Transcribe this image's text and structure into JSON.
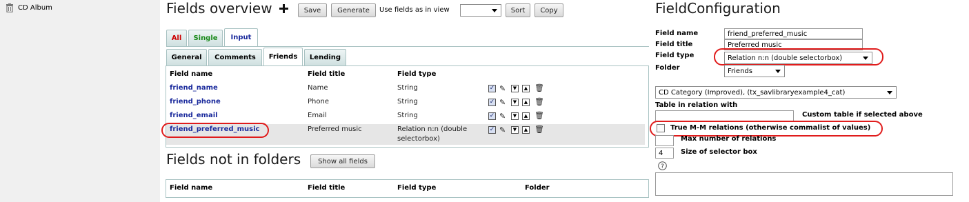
{
  "tree": {
    "item_label": "CD Album",
    "item_icon": "trash-icon"
  },
  "overview": {
    "title": "Fields overview",
    "add_icon": "plus-icon",
    "save_label": "Save",
    "generate_label": "Generate",
    "use_fields_label": "Use fields as in view",
    "view_select_value": "",
    "sort_label": "Sort",
    "copy_label": "Copy"
  },
  "filter_tabs": [
    {
      "label": "All",
      "color": "#cc0000"
    },
    {
      "label": "Single",
      "color": "#1a8a1a"
    },
    {
      "label": "Input",
      "color": "#1a2a9c"
    }
  ],
  "folder_tabs": [
    {
      "label": "General"
    },
    {
      "label": "Comments"
    },
    {
      "label": "Friends",
      "active": true
    },
    {
      "label": "Lending"
    }
  ],
  "fields_table": {
    "headers": {
      "name": "Field name",
      "title": "Field title",
      "type": "Field type"
    },
    "rows": [
      {
        "name": "friend_name",
        "title": "Name",
        "type": "String"
      },
      {
        "name": "friend_phone",
        "title": "Phone",
        "type": "String"
      },
      {
        "name": "friend_email",
        "title": "Email",
        "type": "String"
      },
      {
        "name": "friend_preferred_music",
        "title": "Preferred music",
        "type_line1": "Relation n:n (double",
        "type_line2": "selectorbox)"
      }
    ],
    "row_icons": [
      "checkbox-checked-icon",
      "edit-pen-icon",
      "move-down-icon",
      "move-up-icon",
      "delete-icon"
    ]
  },
  "not_in_folders": {
    "title": "Fields not in folders",
    "show_all_label": "Show all fields",
    "headers": {
      "name": "Field name",
      "title": "Field title",
      "type": "Field type",
      "folder": "Folder"
    }
  },
  "config": {
    "title": "FieldConfiguration",
    "field_name_label": "Field name",
    "field_name_value": "friend_preferred_music",
    "field_title_label": "Field title",
    "field_title_value": "Preferred music",
    "field_type_label": "Field type",
    "field_type_value": "Relation n:n (double selectorbox)",
    "folder_label": "Folder",
    "folder_value": "Friends",
    "category_value": "CD Category (Improved), (tx_savlibraryexample4_cat)",
    "table_relation_label": "Table in relation with",
    "custom_table_label": "Custom table if selected above",
    "custom_table_value": "",
    "true_mm_label": "True M-M relations (otherwise commalist of values)",
    "max_relations_label": "Max number of relations",
    "max_relations_value": "",
    "selector_size_label": "Size of selector box",
    "selector_size_value": "4",
    "help_icon": "help-icon"
  }
}
